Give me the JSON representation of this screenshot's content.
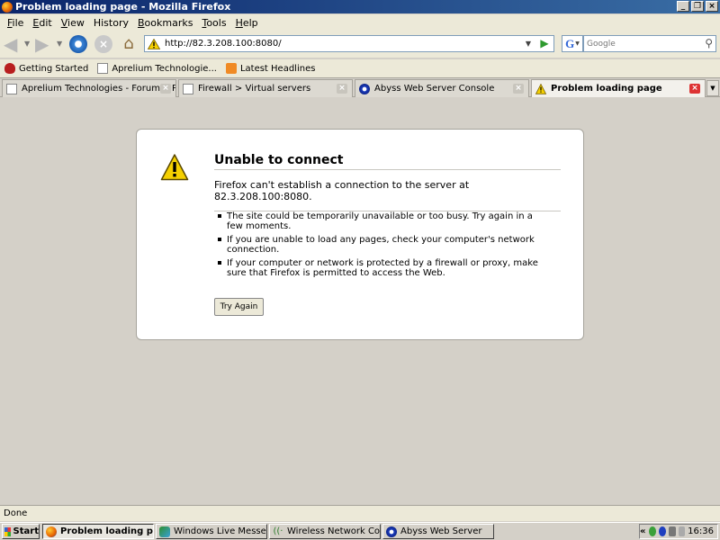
{
  "window": {
    "title": "Problem loading page - Mozilla Firefox"
  },
  "menubar": {
    "items": [
      {
        "key": "F",
        "rest": "ile"
      },
      {
        "key": "E",
        "rest": "dit"
      },
      {
        "key": "V",
        "rest": "iew"
      },
      {
        "key": "",
        "rest": "History"
      },
      {
        "key": "B",
        "rest": "ookmarks"
      },
      {
        "key": "T",
        "rest": "ools"
      },
      {
        "key": "H",
        "rest": "elp"
      }
    ]
  },
  "navbar": {
    "url": "http://82.3.208.100:8080/",
    "search_placeholder": "Google",
    "search_engine_letter": "G"
  },
  "bookmarks": {
    "items": [
      "Getting Started",
      "Aprelium Technologie...",
      "Latest Headlines"
    ]
  },
  "tabs": {
    "items": [
      {
        "label": "Aprelium Technologies - Forum :: Post ..."
      },
      {
        "label": "Firewall > Virtual servers"
      },
      {
        "label": "Abyss Web Server Console"
      },
      {
        "label": "Problem loading page"
      }
    ],
    "active_index": 3
  },
  "error_page": {
    "title": "Unable to connect",
    "short_desc": "Firefox can't establish a connection to the server at 82.3.208.100:8080.",
    "bullets": [
      "The site could be temporarily unavailable or too busy. Try again in a few moments.",
      "If you are unable to load any pages, check your computer's network connection.",
      "If your computer or network is protected by a firewall or proxy, make sure that Firefox is permitted to access the Web."
    ],
    "try_again_label": "Try Again"
  },
  "statusbar": {
    "text": "Done"
  },
  "taskbar": {
    "start_label": "Start",
    "tasks": [
      {
        "label": "Problem loading page..."
      },
      {
        "label": "Windows Live Messenger"
      },
      {
        "label": "Wireless Network Conne..."
      },
      {
        "label": "Abyss Web Server"
      }
    ],
    "clock": "16:36"
  },
  "colors": {
    "titlebar_start": "#0a246a",
    "titlebar_end": "#3a6ea5",
    "warning_yellow": "#f5d000",
    "close_red": "#dd3333"
  }
}
